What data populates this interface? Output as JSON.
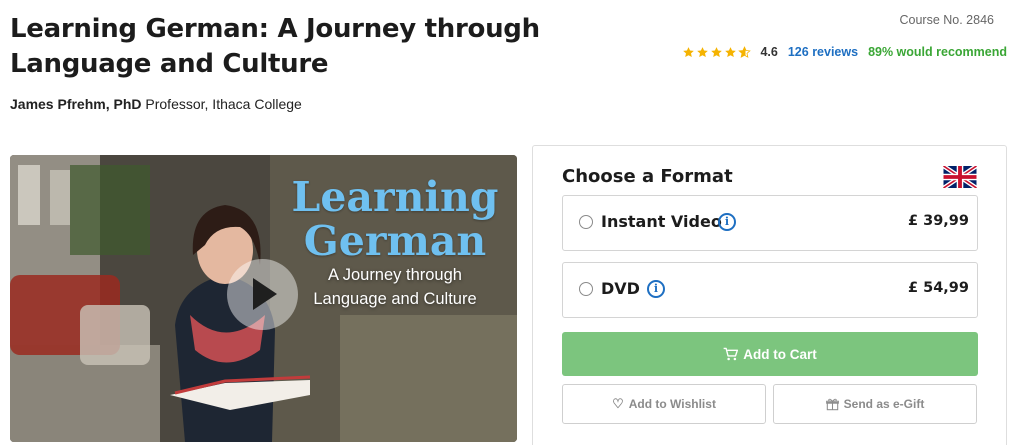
{
  "course": {
    "title": "Learning German: A Journey through Language and Culture",
    "course_no": "Course No. 2846",
    "instructor_name": "James Pfrehm, PhD",
    "instructor_affiliation": "Professor, Ithaca College"
  },
  "rating": {
    "stars": 4.6,
    "value": "4.6",
    "reviews": "126 reviews",
    "recommend": "89% would recommend",
    "star_color": "#f5b301"
  },
  "hero": {
    "title_line1": "Learning",
    "title_line2": "German",
    "subtitle_line1": "A Journey through",
    "subtitle_line2": "Language and Culture",
    "title_color": "#6fc0f0"
  },
  "format": {
    "heading": "Choose a Format",
    "flag_icon": "uk-flag-icon",
    "options": [
      {
        "label": "Instant Video",
        "price": "£ 39,99",
        "selected": false
      },
      {
        "label": "DVD",
        "price": "£ 54,99",
        "selected": false
      }
    ],
    "add_to_cart": "Add to Cart",
    "add_to_wishlist": "Add to Wishlist",
    "send_gift": "Send as e-Gift",
    "accent_color": "#7cc57e",
    "link_color": "#1e6fc2"
  }
}
